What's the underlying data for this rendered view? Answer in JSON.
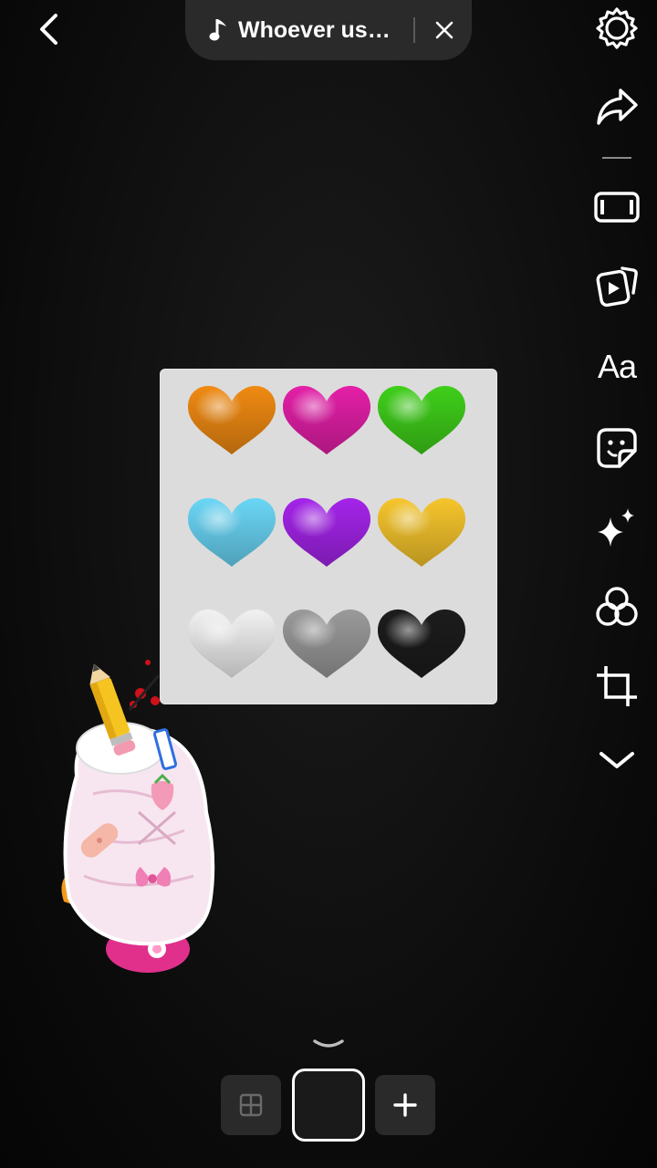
{
  "header": {
    "song_title": "Whoever us…",
    "icons": {
      "back": "chevron-left-icon",
      "music": "music-note-icon",
      "close": "close-icon"
    }
  },
  "toolbar": {
    "items": [
      {
        "name": "settings",
        "icon": "gear-icon"
      },
      {
        "name": "share",
        "icon": "share-arrow-icon"
      },
      {
        "name": "aspect-ratio",
        "icon": "aspect-ratio-icon"
      },
      {
        "name": "video-clips",
        "icon": "video-cards-icon"
      },
      {
        "name": "text",
        "label": "Aa"
      },
      {
        "name": "sticker",
        "icon": "sticker-icon"
      },
      {
        "name": "effects",
        "icon": "sparkles-icon"
      },
      {
        "name": "filters",
        "icon": "filters-icon"
      },
      {
        "name": "crop",
        "icon": "crop-icon"
      },
      {
        "name": "more",
        "icon": "chevron-down-icon"
      }
    ]
  },
  "canvas": {
    "hearts": [
      {
        "name": "orange-heart",
        "color": "#f08a12"
      },
      {
        "name": "pink-heart",
        "color": "#e41fa8"
      },
      {
        "name": "green-heart",
        "color": "#3fcf1a"
      },
      {
        "name": "light-blue-heart",
        "color": "#6ad6f6"
      },
      {
        "name": "purple-heart",
        "color": "#a424ea"
      },
      {
        "name": "yellow-heart",
        "color": "#f6c52c"
      },
      {
        "name": "white-heart",
        "color": "#f2f2f2"
      },
      {
        "name": "grey-heart",
        "color": "#9a9a9a"
      },
      {
        "name": "black-heart",
        "color": "#1c1c1c"
      }
    ]
  },
  "bottom_tray": {
    "icons": {
      "expand": "chevron-up-icon",
      "grid": "grid-icon",
      "add": "plus-icon"
    }
  }
}
